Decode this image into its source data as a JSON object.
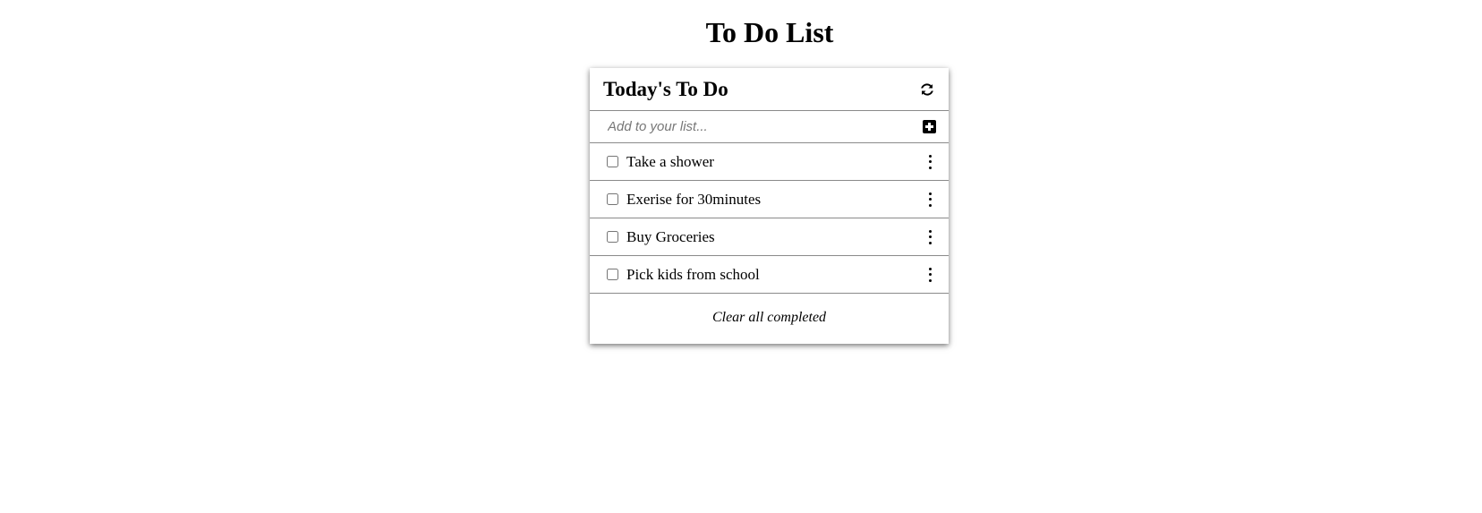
{
  "page": {
    "title": "To Do List"
  },
  "card": {
    "title": "Today's To Do",
    "refresh_icon": "refresh-icon",
    "add": {
      "placeholder": "Add to your list...",
      "value": "",
      "icon": "plus-square-icon"
    },
    "items": [
      {
        "label": "Take a shower",
        "checked": false
      },
      {
        "label": "Exerise for 30minutes",
        "checked": false
      },
      {
        "label": "Buy Groceries",
        "checked": false
      },
      {
        "label": "Pick kids from school",
        "checked": false
      }
    ],
    "item_menu_icon": "vertical-ellipsis-icon",
    "clear_label": "Clear all completed"
  }
}
